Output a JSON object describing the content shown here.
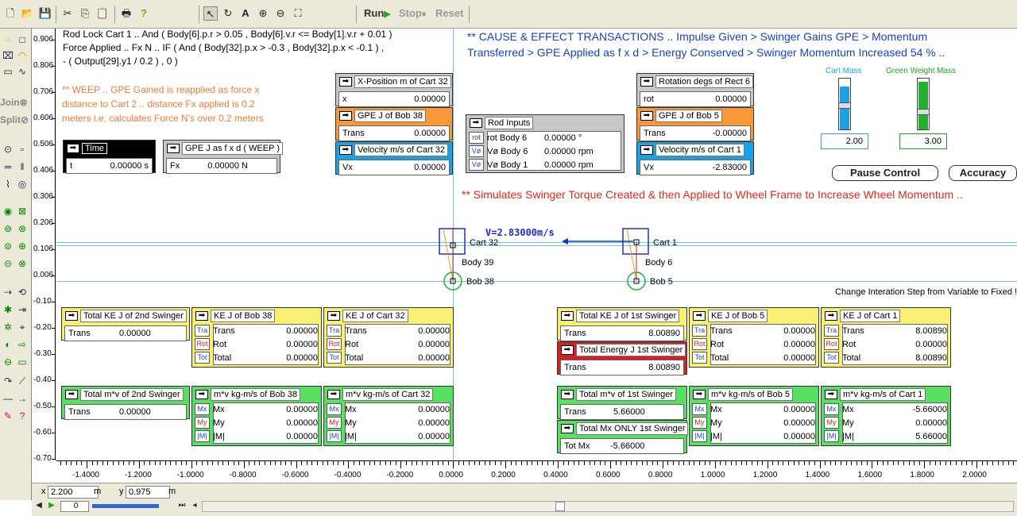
{
  "toolbar": {
    "run": "Run",
    "stop": "Stop",
    "reset": "Reset"
  },
  "left_tools": {
    "join": "Join",
    "split": "Split"
  },
  "y_ticks": [
    "0.906",
    "0.806",
    "0.706",
    "0.606",
    "0.506",
    "0.406",
    "0.306",
    "0.206",
    "0.106",
    "0.006",
    "-0.10",
    "-0.20",
    "-0.30",
    "-0.40",
    "-0.50",
    "-0.60",
    "-0.70"
  ],
  "x_ticks": [
    "-1.4000",
    "-1.2000",
    "-1.0000",
    "-0.8000",
    "-0.6000",
    "-0.4000",
    "-0.2000",
    "0.0000",
    "0.2000",
    "0.4000",
    "0.6000",
    "0.8000",
    "1.0000",
    "1.2000",
    "1.4000",
    "1.6000",
    "1.8000",
    "2.0000"
  ],
  "formula": {
    "line1": "Rod Lock Cart 1 .. And ( Body[6].p.r > 0.05 , Body[6].v.r <= Body[1].v.r + 0.01 )",
    "line2": "Force Applied .. Fx N .. IF ( And ( Body[32].p.x > -0.3 , Body[32].p.x < -0.1 )  ,",
    "line3": "- ( Output[29].y1 / 0.2 )  , 0 )"
  },
  "weep": {
    "line1": "** WEEP .. GPE Gained is reapplied as force x",
    "line2": "distance to Cart 2 .. distance Fx applied is 0.2",
    "line3": "meters i.e. calculates Force N's over 0.2 meters"
  },
  "cause": {
    "line1": "** CAUSE & EFFECT TRANSACTIONS .. Impulse Given > Swinger Gains GPE > Momentum",
    "line2": "Transferred > GPE Applied as f x d > Energy Conserved > Swinger Momentum Increased 54 % .."
  },
  "simulates": "** Simulates Swinger Torque Created & then Applied to Wheel Frame to Increase Wheel Momentum ..",
  "change_step": "Change Interation Step from Variable to Fixed !",
  "velocity_label": "V=2.83000m/s",
  "bodies": {
    "cart32": "Cart 32",
    "body39": "Body 39",
    "bob38": "Bob 38",
    "cart1": "Cart 1",
    "body6": "Body 6",
    "bob5": "Bob 5"
  },
  "meters": {
    "time": {
      "title": "Time",
      "key": "t",
      "value": "0.00000 s"
    },
    "gpe_fxd": {
      "title": "GPE J as f x d ( WEEP )",
      "key": "Fx",
      "value": "0.00000 N"
    },
    "xpos_cart32": {
      "title": "X-Position m of Cart 32",
      "key": "x",
      "value": "0.00000"
    },
    "gpe_bob38": {
      "title": "GPE J of Bob 38",
      "key": "Trans",
      "value": "0.00000"
    },
    "vel_cart32": {
      "title": "Velocity m/s of Cart 32",
      "key": "Vx",
      "value": "0.00000"
    },
    "rod_inputs": {
      "title": "Rod Inputs",
      "rows": [
        {
          "tag": "rot",
          "key": "rot Body 6",
          "value": "0.00000 °"
        },
        {
          "tag": "Vø",
          "key": "Vø Body 6",
          "value": "0.00000 rpm"
        },
        {
          "tag": "Vø",
          "key": "Vø Body 1",
          "value": "0.00000 rpm"
        }
      ]
    },
    "rot_rect6": {
      "title": "Rotation degs of Rect 6",
      "key": "rot",
      "value": "0.00000"
    },
    "gpe_bob5": {
      "title": "GPE J of Bob 5",
      "key": "Trans",
      "value": "-0.00000"
    },
    "vel_cart1": {
      "title": "Velocity m/s of Cart 1",
      "key": "Vx",
      "value": "-2.83000"
    },
    "total_ke_2nd": {
      "title": "Total KE J of 2nd Swinger",
      "key": "Trans",
      "value": "0.00000"
    },
    "ke_bob38": {
      "title": "KE J of Bob 38",
      "rows": [
        {
          "tag": "Tra",
          "key": "Trans",
          "value": "0.00000"
        },
        {
          "tag": "Rot",
          "key": "Rot",
          "value": "0.00000"
        },
        {
          "tag": "Tot",
          "key": "Total",
          "value": "0.00000"
        }
      ]
    },
    "ke_cart32": {
      "title": "KE J of Cart 32",
      "rows": [
        {
          "tag": "Tra",
          "key": "Trans",
          "value": "0.00000"
        },
        {
          "tag": "Rot",
          "key": "Rot",
          "value": "0.00000"
        },
        {
          "tag": "Tot",
          "key": "Total",
          "value": "0.00000"
        }
      ]
    },
    "total_ke_1st": {
      "title": "Total KE J of 1st Swinger",
      "key": "Trans",
      "value": "8.00890"
    },
    "total_energy_1st": {
      "title": "Total Energy J 1st Swinger",
      "key": "Trans",
      "value": "8.00890"
    },
    "ke_bob5": {
      "title": "KE J of Bob 5",
      "rows": [
        {
          "tag": "Tra",
          "key": "Trans",
          "value": "0.00000"
        },
        {
          "tag": "Rot",
          "key": "Rot",
          "value": "0.00000"
        },
        {
          "tag": "Tot",
          "key": "Total",
          "value": "0.00000"
        }
      ]
    },
    "ke_cart1": {
      "title": "KE J of Cart 1",
      "rows": [
        {
          "tag": "Tra",
          "key": "Trans",
          "value": "8.00890"
        },
        {
          "tag": "Rot",
          "key": "Rot",
          "value": "0.00000"
        },
        {
          "tag": "Tot",
          "key": "Total",
          "value": "8.00890"
        }
      ]
    },
    "total_mv_2nd": {
      "title": "Total m*v of 2nd Swinger",
      "key": "Trans",
      "value": "0.00000"
    },
    "mv_bob38": {
      "title": "m*v kg-m/s of Bob 38",
      "rows": [
        {
          "tag": "Mx",
          "key": "Mx",
          "value": "0.00000"
        },
        {
          "tag": "My",
          "key": "My",
          "value": "0.00000"
        },
        {
          "tag": "|M|",
          "key": "|M|",
          "value": "0.00000"
        }
      ]
    },
    "mv_cart32": {
      "title": "m*v kg-m/s of Cart 32",
      "rows": [
        {
          "tag": "Mx",
          "key": "Mx",
          "value": "0.00000"
        },
        {
          "tag": "My",
          "key": "My",
          "value": "0.00000"
        },
        {
          "tag": "|M|",
          "key": "|M|",
          "value": "0.00000"
        }
      ]
    },
    "total_mv_1st": {
      "title": "Total m*v of 1st Swinger",
      "key": "Trans",
      "value": "5.66000"
    },
    "total_mx_only": {
      "title": "Total Mx ONLY 1st Swinger",
      "key": "Tot Mx",
      "value": "-5.66000"
    },
    "mv_bob5": {
      "title": "m*v kg-m/s of Bob 5",
      "rows": [
        {
          "tag": "Mx",
          "key": "Mx",
          "value": "0.00000"
        },
        {
          "tag": "My",
          "key": "My",
          "value": "0.00000"
        },
        {
          "tag": "|M|",
          "key": "|M|",
          "value": "0.00000"
        }
      ]
    },
    "mv_cart1": {
      "title": "m*v kg-m/s of Cart 1",
      "rows": [
        {
          "tag": "Mx",
          "key": "Mx",
          "value": "-5.66000"
        },
        {
          "tag": "My",
          "key": "My",
          "value": "0.00000"
        },
        {
          "tag": "|M|",
          "key": "|M|",
          "value": "5.66000"
        }
      ]
    }
  },
  "controls": {
    "cart_mass_label": "Cart Mass",
    "cart_mass_value": "2.00",
    "weight_mass_label": "Green Weight Mass",
    "weight_mass_value": "3.00",
    "pause": "Pause Control",
    "accuracy": "Accuracy"
  },
  "status": {
    "x_label": "x",
    "x_value": "2.200",
    "x_unit": "m",
    "y_label": "y",
    "y_value": "0.975",
    "y_unit": "m",
    "frame": "0"
  },
  "colors": {
    "yellow": "#f8f070",
    "orange": "#f89838",
    "blue": "#1ba2e6",
    "green": "#58e060",
    "red": "#d42020"
  }
}
